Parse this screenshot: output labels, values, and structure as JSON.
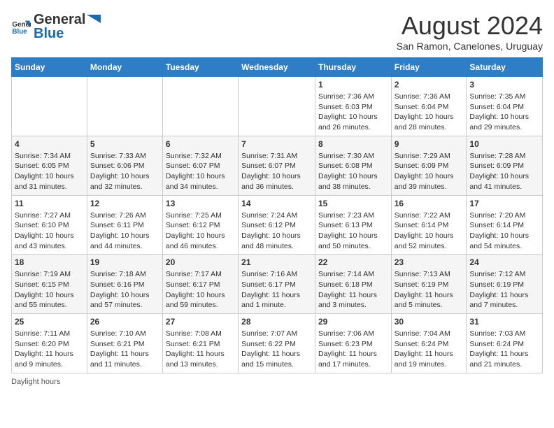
{
  "header": {
    "logo_general": "General",
    "logo_blue": "Blue",
    "month_year": "August 2024",
    "location": "San Ramon, Canelones, Uruguay"
  },
  "days_of_week": [
    "Sunday",
    "Monday",
    "Tuesday",
    "Wednesday",
    "Thursday",
    "Friday",
    "Saturday"
  ],
  "weeks": [
    [
      {
        "day": "",
        "info": ""
      },
      {
        "day": "",
        "info": ""
      },
      {
        "day": "",
        "info": ""
      },
      {
        "day": "",
        "info": ""
      },
      {
        "day": "1",
        "info": "Sunrise: 7:36 AM\nSunset: 6:03 PM\nDaylight: 10 hours and 26 minutes."
      },
      {
        "day": "2",
        "info": "Sunrise: 7:36 AM\nSunset: 6:04 PM\nDaylight: 10 hours and 28 minutes."
      },
      {
        "day": "3",
        "info": "Sunrise: 7:35 AM\nSunset: 6:04 PM\nDaylight: 10 hours and 29 minutes."
      }
    ],
    [
      {
        "day": "4",
        "info": "Sunrise: 7:34 AM\nSunset: 6:05 PM\nDaylight: 10 hours and 31 minutes."
      },
      {
        "day": "5",
        "info": "Sunrise: 7:33 AM\nSunset: 6:06 PM\nDaylight: 10 hours and 32 minutes."
      },
      {
        "day": "6",
        "info": "Sunrise: 7:32 AM\nSunset: 6:07 PM\nDaylight: 10 hours and 34 minutes."
      },
      {
        "day": "7",
        "info": "Sunrise: 7:31 AM\nSunset: 6:07 PM\nDaylight: 10 hours and 36 minutes."
      },
      {
        "day": "8",
        "info": "Sunrise: 7:30 AM\nSunset: 6:08 PM\nDaylight: 10 hours and 38 minutes."
      },
      {
        "day": "9",
        "info": "Sunrise: 7:29 AM\nSunset: 6:09 PM\nDaylight: 10 hours and 39 minutes."
      },
      {
        "day": "10",
        "info": "Sunrise: 7:28 AM\nSunset: 6:09 PM\nDaylight: 10 hours and 41 minutes."
      }
    ],
    [
      {
        "day": "11",
        "info": "Sunrise: 7:27 AM\nSunset: 6:10 PM\nDaylight: 10 hours and 43 minutes."
      },
      {
        "day": "12",
        "info": "Sunrise: 7:26 AM\nSunset: 6:11 PM\nDaylight: 10 hours and 44 minutes."
      },
      {
        "day": "13",
        "info": "Sunrise: 7:25 AM\nSunset: 6:12 PM\nDaylight: 10 hours and 46 minutes."
      },
      {
        "day": "14",
        "info": "Sunrise: 7:24 AM\nSunset: 6:12 PM\nDaylight: 10 hours and 48 minutes."
      },
      {
        "day": "15",
        "info": "Sunrise: 7:23 AM\nSunset: 6:13 PM\nDaylight: 10 hours and 50 minutes."
      },
      {
        "day": "16",
        "info": "Sunrise: 7:22 AM\nSunset: 6:14 PM\nDaylight: 10 hours and 52 minutes."
      },
      {
        "day": "17",
        "info": "Sunrise: 7:20 AM\nSunset: 6:14 PM\nDaylight: 10 hours and 54 minutes."
      }
    ],
    [
      {
        "day": "18",
        "info": "Sunrise: 7:19 AM\nSunset: 6:15 PM\nDaylight: 10 hours and 55 minutes."
      },
      {
        "day": "19",
        "info": "Sunrise: 7:18 AM\nSunset: 6:16 PM\nDaylight: 10 hours and 57 minutes."
      },
      {
        "day": "20",
        "info": "Sunrise: 7:17 AM\nSunset: 6:17 PM\nDaylight: 10 hours and 59 minutes."
      },
      {
        "day": "21",
        "info": "Sunrise: 7:16 AM\nSunset: 6:17 PM\nDaylight: 11 hours and 1 minute."
      },
      {
        "day": "22",
        "info": "Sunrise: 7:14 AM\nSunset: 6:18 PM\nDaylight: 11 hours and 3 minutes."
      },
      {
        "day": "23",
        "info": "Sunrise: 7:13 AM\nSunset: 6:19 PM\nDaylight: 11 hours and 5 minutes."
      },
      {
        "day": "24",
        "info": "Sunrise: 7:12 AM\nSunset: 6:19 PM\nDaylight: 11 hours and 7 minutes."
      }
    ],
    [
      {
        "day": "25",
        "info": "Sunrise: 7:11 AM\nSunset: 6:20 PM\nDaylight: 11 hours and 9 minutes."
      },
      {
        "day": "26",
        "info": "Sunrise: 7:10 AM\nSunset: 6:21 PM\nDaylight: 11 hours and 11 minutes."
      },
      {
        "day": "27",
        "info": "Sunrise: 7:08 AM\nSunset: 6:21 PM\nDaylight: 11 hours and 13 minutes."
      },
      {
        "day": "28",
        "info": "Sunrise: 7:07 AM\nSunset: 6:22 PM\nDaylight: 11 hours and 15 minutes."
      },
      {
        "day": "29",
        "info": "Sunrise: 7:06 AM\nSunset: 6:23 PM\nDaylight: 11 hours and 17 minutes."
      },
      {
        "day": "30",
        "info": "Sunrise: 7:04 AM\nSunset: 6:24 PM\nDaylight: 11 hours and 19 minutes."
      },
      {
        "day": "31",
        "info": "Sunrise: 7:03 AM\nSunset: 6:24 PM\nDaylight: 11 hours and 21 minutes."
      }
    ]
  ],
  "footer": {
    "note": "Daylight hours"
  }
}
